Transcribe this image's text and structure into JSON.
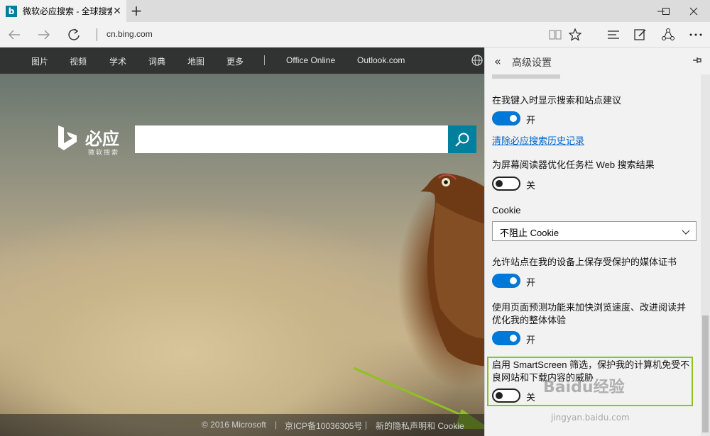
{
  "tab": {
    "title": "微软必应搜索 - 全球搜索",
    "favicon": "b"
  },
  "address": {
    "url": "cn.bing.com"
  },
  "page": {
    "nav": [
      "图片",
      "视频",
      "学术",
      "词典",
      "地图",
      "更多",
      "Office Online",
      "Outlook.com"
    ],
    "logo_text": "必应",
    "logo_sub": "微软搜索",
    "search_placeholder": "",
    "footer": [
      "© 2016 Microsoft",
      "|",
      "京ICP备10036305号",
      "|",
      "新的隐私声明和 Cookie"
    ]
  },
  "panel": {
    "title": "高级设置",
    "settings": [
      {
        "label": "在我键入时显示搜索和站点建议",
        "state": "开"
      },
      {
        "link": "清除必应搜索历史记录"
      },
      {
        "label": "为屏幕阅读器优化任务栏 Web 搜索结果",
        "state": "关"
      },
      {
        "label": "Cookie",
        "value": "不阻止 Cookie"
      },
      {
        "label": "允许站点在我的设备上保存受保护的媒体证书",
        "state": "开"
      },
      {
        "label": "使用页面预测功能来加快浏览速度、改进阅读并优化我的整体体验",
        "state": "开"
      },
      {
        "label": "启用 SmartScreen 筛选，保护我的计算机免受不良网站和下载内容的威胁",
        "state": "关"
      }
    ],
    "accent_color": "#0078d7",
    "highlight_color": "#8dc21f"
  },
  "watermark": {
    "text": "Baidu经验",
    "sub": "jingyan.baidu.com"
  }
}
